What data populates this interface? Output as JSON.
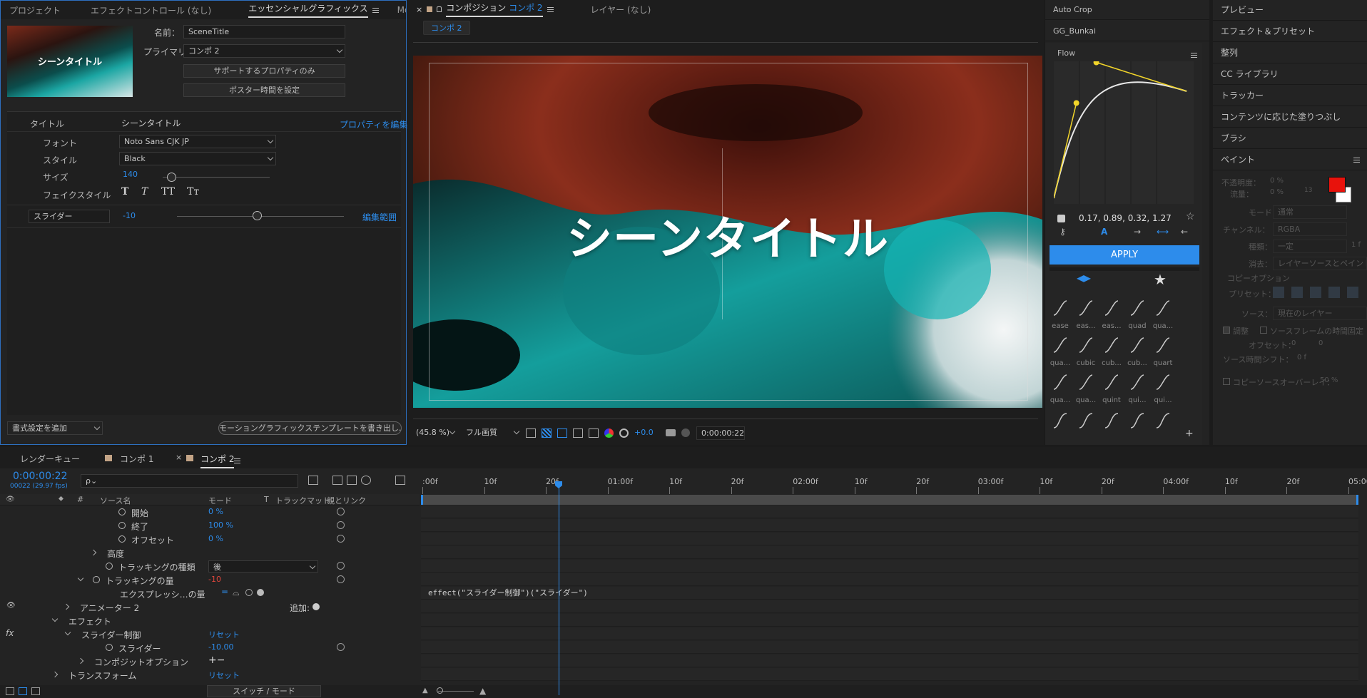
{
  "left_panel": {
    "tabs": [
      "プロジェクト",
      "エフェクトコントロール (なし)",
      "エッセンシャルグラフィックス",
      "Motion Bro"
    ],
    "thumb_text": "シーンタイトル",
    "name_label": "名前：",
    "name_value": "SceneTitle",
    "primary_label": "プライマリ：",
    "primary_value": "コンポ 2",
    "btn_supported": "サポートするプロパティのみ",
    "btn_poster": "ポスター時間を設定",
    "prop_title_label": "タイトル",
    "prop_title_value": "シーンタイトル",
    "edit_props": "プロパティを編集",
    "font_label": "フォント",
    "font_value": "Noto Sans CJK JP",
    "style_label": "スタイル",
    "style_value": "Black",
    "size_label": "サイズ",
    "size_value": "140",
    "faux_label": "フェイクスタイル",
    "faux_buttons": [
      "T",
      "T",
      "TT",
      "Tт"
    ],
    "slider_name": "スライダー",
    "slider_value": "-10",
    "edit_range": "編集範囲",
    "add_format": "書式設定を追加",
    "export_btn": "モーショングラフィックステンプレートを書き出し..."
  },
  "comp_panel": {
    "close": "×",
    "tab_comp": "コンポジション",
    "tab_comp_name": "コンポ 2",
    "tab_layer": "レイヤー (なし)",
    "breadcrumb": "コンポ 2",
    "title_text": "シーンタイトル",
    "zoom": "(45.8 %)",
    "quality": "フル画質",
    "exposure": "+0.0",
    "timecode": "0:00:00:22"
  },
  "flow_panel": {
    "item1": "Auto Crop",
    "item2": "GG_Bunkai",
    "title": "Flow",
    "values": "0.17, 0.89, 0.32, 1.27",
    "apply": "APPLY",
    "presets": [
      "ease",
      "eas...",
      "eas...",
      "quad",
      "qua...",
      "qua...",
      "cubic",
      "cub...",
      "cub...",
      "quart",
      "qua...",
      "qua...",
      "quint",
      "qui...",
      "qui..."
    ],
    "curve_points": [
      [
        0,
        0
      ],
      [
        0.17,
        0.89
      ],
      [
        0.32,
        1.27
      ],
      [
        1,
        1
      ]
    ]
  },
  "right_panel": {
    "items": [
      "プレビュー",
      "エフェクト＆プリセット",
      "整列",
      "CC ライブラリ",
      "トラッカー",
      "コンテンツに応じた塗りつぶし",
      "ブラシ"
    ],
    "paint_title": "ペイント",
    "opacity_label": "不透明度：",
    "opacity_value": "0 %",
    "flow_label": "流量：",
    "flow_value": "0 %",
    "brush_size": "13",
    "mode_label": "モード：",
    "mode_value": "通常",
    "channel_label": "チャンネル：",
    "channel_value": "RGBA",
    "type_label": "種類：",
    "type_value": "一定",
    "type_num": "1 f",
    "erase_label": "消去：",
    "erase_value": "レイヤーソースとペイント",
    "copy_opt": "コピーオプション",
    "preset_label": "プリセット：",
    "source_label": "ソース：",
    "source_value": "現在のレイヤー",
    "align_label": "調整",
    "lock_label": "ソースフレームの時間固定",
    "offset_label": "オフセット：",
    "offset_x": "0",
    "offset_y": "0",
    "time_shift": "ソース時間シフト：",
    "time_shift_value": "0 f",
    "overlay_label": "コピーソースオーバーレイ：",
    "overlay_value": "50 %",
    "fg_color": "#e8120c",
    "bg_color": "#ffffff"
  },
  "timeline": {
    "tabs": [
      "レンダーキュー",
      "コンポ 1",
      "コンポ 2"
    ],
    "time": "0:00:00:22",
    "fps": "00022 (29.97 fps)",
    "search_placeholder": "ρ⌄",
    "columns": [
      "#",
      "ソース名",
      "モード",
      "T",
      "トラックマット",
      "親とリンク"
    ],
    "ruler": [
      ":00f",
      "10f",
      "20f",
      "01:00f",
      "10f",
      "20f",
      "02:00f",
      "10f",
      "20f",
      "03:00f",
      "10f",
      "20f",
      "04:00f",
      "10f",
      "20f",
      "05:00"
    ],
    "rows": [
      {
        "name": "開始",
        "value": "0 %"
      },
      {
        "name": "終了",
        "value": "100 %"
      },
      {
        "name": "オフセット",
        "value": "0 %"
      },
      {
        "name": "高度",
        "value": ""
      },
      {
        "name": "トラッキングの種類",
        "value": "後"
      },
      {
        "name": "トラッキングの量",
        "value": "-10"
      },
      {
        "name": "エクスプレッシ…の量",
        "value": ""
      },
      {
        "name": "アニメーター 2",
        "value": "追加:"
      },
      {
        "name": "エフェクト",
        "value": ""
      },
      {
        "name": "スライダー制御",
        "value": "リセット"
      },
      {
        "name": "スライダー",
        "value": "-10.00"
      },
      {
        "name": "コンポジットオプション",
        "value": "+−"
      },
      {
        "name": "トランスフォーム",
        "value": "リセット"
      }
    ],
    "expression": "effect(\"スライダー制御\")(\"スライダー\")",
    "switch_mode": "スイッチ / モード"
  }
}
